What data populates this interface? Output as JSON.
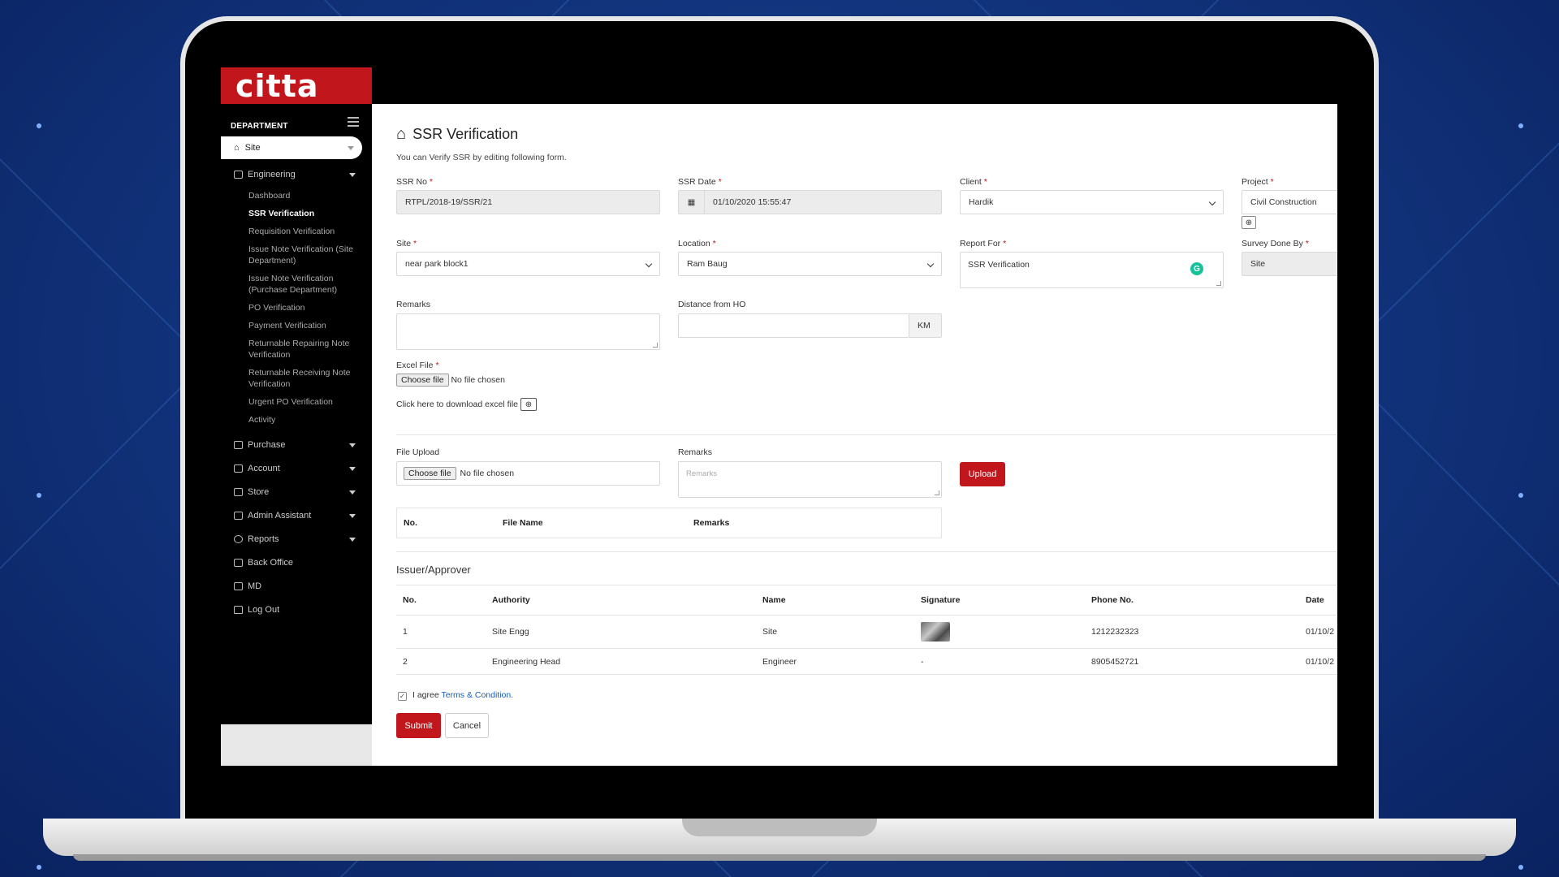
{
  "brand": {
    "logo_text": "citta",
    "accent": "#c0161c"
  },
  "sidebar": {
    "heading": "DEPARTMENT",
    "current": "Site",
    "groups": [
      {
        "label": "Engineering",
        "icon": "briefcase-icon"
      },
      {
        "label": "Purchase",
        "icon": "inbox-icon"
      },
      {
        "label": "Account",
        "icon": "calculator-icon"
      },
      {
        "label": "Store",
        "icon": "wrench-icon"
      },
      {
        "label": "Admin Assistant",
        "icon": "pencil-icon"
      },
      {
        "label": "Reports",
        "icon": "gear-icon"
      },
      {
        "label": "Back Office",
        "icon": "briefcase-icon"
      },
      {
        "label": "MD",
        "icon": "briefcase-icon"
      },
      {
        "label": "Log Out",
        "icon": "lock-icon"
      }
    ],
    "engineering_items": [
      "Dashboard",
      "SSR Verification",
      "Requisition Verification",
      "Issue Note Verification (Site Department)",
      "Issue Note Verification (Purchase Department)",
      "PO Verification",
      "Payment Verification",
      "Returnable Repairing Note Verification",
      "Returnable Receiving Note Verification",
      "Urgent PO Verification",
      "Activity"
    ]
  },
  "page": {
    "title": "SSR Verification",
    "subtitle": "You can Verify SSR by editing following form."
  },
  "form": {
    "ssr_no": {
      "label": "SSR No",
      "value": "RTPL/2018-19/SSR/21"
    },
    "ssr_date": {
      "label": "SSR Date",
      "value": "01/10/2020 15:55:47"
    },
    "client": {
      "label": "Client",
      "value": "Hardik"
    },
    "project": {
      "label": "Project",
      "value": "Civil Construction"
    },
    "site": {
      "label": "Site",
      "value": "near park block1"
    },
    "location": {
      "label": "Location",
      "value": "Ram Baug"
    },
    "report_for": {
      "label": "Report For",
      "value": "SSR Verification"
    },
    "survey_done_by": {
      "label": "Survey Done By",
      "value": "Site"
    },
    "remarks": {
      "label": "Remarks",
      "value": ""
    },
    "distance": {
      "label": "Distance from HO",
      "value": "",
      "unit": "KM"
    },
    "excel_file": {
      "label": "Excel File",
      "button": "Choose file",
      "status": "No file chosen"
    },
    "download_text": "Click here to download excel file",
    "file_upload": {
      "label": "File Upload",
      "button": "Choose file",
      "status": "No file chosen"
    },
    "upload_remarks": {
      "label": "Remarks",
      "placeholder": "Remarks"
    },
    "upload_button": "Upload"
  },
  "files_table": {
    "headers": [
      "No.",
      "File Name",
      "Remarks"
    ]
  },
  "approver": {
    "title": "Issuer/Approver",
    "headers": [
      "No.",
      "Authority",
      "Name",
      "Signature",
      "Phone No.",
      "Date"
    ],
    "rows": [
      {
        "no": "1",
        "authority": "Site Engg",
        "name": "Site",
        "signature": "",
        "phone": "1212232323",
        "date": "01/10/2"
      },
      {
        "no": "2",
        "authority": "Engineering Head",
        "name": "Engineer",
        "signature": "-",
        "phone": "8905452721",
        "date": "01/10/2"
      }
    ]
  },
  "agree": {
    "prefix": "I agree",
    "link": "Terms & Condition."
  },
  "actions": {
    "submit": "Submit",
    "cancel": "Cancel"
  }
}
